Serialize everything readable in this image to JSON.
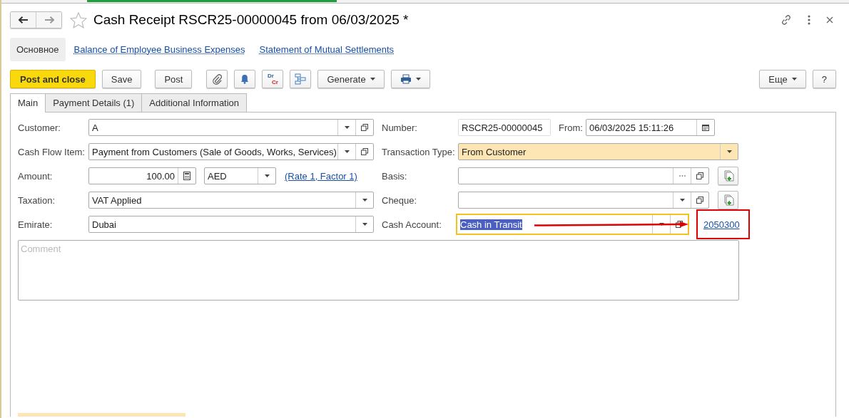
{
  "window": {
    "title": "Cash Receipt RSCR25-00000045 from 06/03/2025 *",
    "favorite": false
  },
  "sections": [
    {
      "label": "Основное",
      "selected": true
    },
    {
      "label": "Balance of Employee Business Expenses",
      "selected": false
    },
    {
      "label": "Statement of Mutual Settlements",
      "selected": false
    }
  ],
  "toolbar": [
    {
      "kind": "primary",
      "label": "Post and close"
    },
    {
      "kind": "text",
      "label": "Save"
    },
    {
      "kind": "text",
      "label": "Post"
    },
    {
      "kind": "attach"
    },
    {
      "kind": "reminder"
    },
    {
      "kind": "drcr",
      "label": "Dr",
      "label_2": "Cr"
    },
    {
      "kind": "structure"
    },
    {
      "kind": "menu",
      "label": "Generate"
    },
    {
      "kind": "print"
    }
  ],
  "toolbar_right": [
    {
      "kind": "menu",
      "label": "Еще"
    },
    {
      "kind": "text",
      "label": "?"
    }
  ],
  "tabs": [
    {
      "label": "Main",
      "selected": true
    },
    {
      "label": "Payment Details (1)",
      "selected": false
    },
    {
      "label": "Additional Information",
      "selected": false
    }
  ],
  "left_fields": [
    {
      "kind": "select",
      "label": "Customer:",
      "value": "A",
      "open_button": true
    },
    {
      "kind": "select",
      "label": "Cash Flow Item:",
      "value": "Payment from Customers (Sale of Goods, Works, Services)",
      "open_button": true
    },
    {
      "kind": "amount",
      "label": "Amount:",
      "value": "100.00",
      "currency": "AED",
      "link": "(Rate 1, Factor 1)"
    },
    {
      "kind": "select",
      "label": "Taxation:",
      "value": "VAT Applied",
      "open_button": false
    },
    {
      "kind": "select",
      "label": "Emirate:",
      "value": "Dubai",
      "open_button": false
    }
  ],
  "right_fields": [
    {
      "kind": "number",
      "label": "Number:",
      "value": "RSCR25-00000045",
      "date_label": "From:",
      "date_value": "06/03/2025 15:11:26"
    },
    {
      "kind": "select",
      "label": "Transaction Type:",
      "value": "From Customer",
      "open_button": false,
      "highlighted": true
    },
    {
      "kind": "reference",
      "label": "Basis:",
      "choice_list": false
    },
    {
      "kind": "reference",
      "label": "Cheque:",
      "choice_list": true
    },
    {
      "kind": "account",
      "label": "Cash Account:",
      "value": "Cash in Transit",
      "focused": true,
      "text_selected": true,
      "arrow": true,
      "link": "2050300",
      "link_boxed": true
    }
  ],
  "comment": {
    "placeholder": "Comment"
  }
}
